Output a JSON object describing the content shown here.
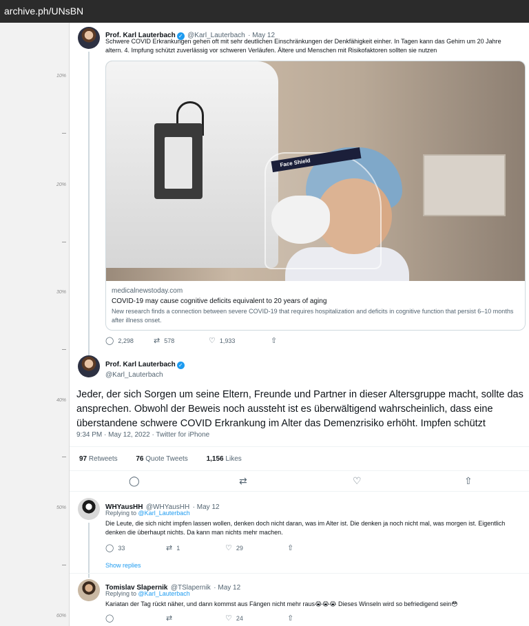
{
  "browser": {
    "url": "archive.ph/UNsBN"
  },
  "ruler": [
    "10%",
    "20%",
    "30%",
    "40%",
    "50%",
    "60%"
  ],
  "tweet1": {
    "name": "Prof. Karl Lauterbach",
    "handle": "@Karl_Lauterbach",
    "date": "· May 12",
    "text": "Schwere COVID Erkrankungen gehen oft mit sehr deutlichen Einschränkungen der Denkfähigkeit einher. In Tagen kann das Gehirn um 20 Jahre altern. 4. Impfung schützt zuverlässig vor schweren Verläufen. Ältere und Menschen mit Risikofaktoren sollten sie nutzen",
    "card": {
      "domain": "medicalnewstoday.com",
      "title": "COVID-19 may cause cognitive deficits equivalent to 20 years of aging",
      "description": "New research finds a connection between severe COVID-19 that requires hospitalization and deficits in cognitive function that persist 6–10 months after illness onset.",
      "image_text": "Face Shield"
    },
    "replies": "2,298",
    "retweets": "578",
    "likes": "1,933"
  },
  "tweet2": {
    "name": "Prof. Karl Lauterbach",
    "handle": "@Karl_Lauterbach",
    "text": "Jeder, der sich Sorgen um seine Eltern, Freunde und Partner in dieser Altersgruppe macht, sollte das ansprechen. Obwohl der Beweis noch aussteht ist es überwältigend wahrscheinlich, dass eine überstandene schwere COVID Erkrankung im Alter das Demenzrisiko erhöht. Impfen schützt",
    "timestamp": "9:34 PM · May 12, 2022 · Twitter for iPhone",
    "stats": {
      "retweets_count": "97",
      "retweets_label": "Retweets",
      "quotes_count": "76",
      "quotes_label": "Quote Tweets",
      "likes_count": "1,156",
      "likes_label": "Likes"
    }
  },
  "reply1": {
    "name": "WHYausHH",
    "handle": "@WHYausHH",
    "date": "· May 12",
    "replying_label": "Replying to",
    "replying_to": "@Karl_Lauterbach",
    "text": "Die Leute, die sich nicht impfen lassen wollen, denken doch nicht daran, was im Alter ist. Die denken ja noch nicht mal, was morgen ist. Eigentlich denken die überhaupt nichts. Da kann man nichts mehr machen.",
    "replies": "33",
    "retweets": "1",
    "likes": "29",
    "show_replies": "Show replies"
  },
  "reply2": {
    "name": "Tomislav Slapernik",
    "handle": "@TSlapernik",
    "date": "· May 12",
    "replying_label": "Replying to",
    "replying_to": "@Karl_Lauterbach",
    "text": "Kariatan der Tag rückt näher, und dann kommst aus Fängen nicht mehr raus😭😭😭 Dieses Winseln wird so befriedigend sein😳",
    "replies": "",
    "retweets": "",
    "likes": "24"
  }
}
